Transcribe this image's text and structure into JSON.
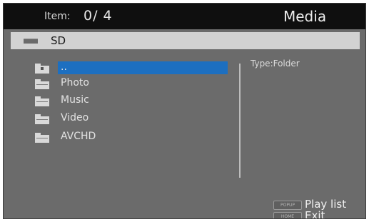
{
  "header": {
    "item_label": "Item:",
    "item_count": "0/ 4",
    "title": "Media"
  },
  "path": {
    "icon": "drive-icon",
    "label": "SD"
  },
  "file_list": {
    "items": [
      {
        "label": "..",
        "icon": "parent-folder-icon",
        "selected": true
      },
      {
        "label": "Photo",
        "icon": "folder-icon",
        "selected": false
      },
      {
        "label": "Music",
        "icon": "folder-icon",
        "selected": false
      },
      {
        "label": "Video",
        "icon": "folder-icon",
        "selected": false
      },
      {
        "label": "AVCHD",
        "icon": "folder-icon",
        "selected": false
      }
    ]
  },
  "info": {
    "type_text": "Type:Folder"
  },
  "footer": {
    "popup_key": "POPUP",
    "popup_action": "Play list",
    "home_key": "HOME",
    "home_action": "Exit"
  },
  "colors": {
    "background": "#6b6b6b",
    "header": "#0f0f0f",
    "pathbar": "#d2d2d2",
    "selection": "#1d6fc0"
  }
}
